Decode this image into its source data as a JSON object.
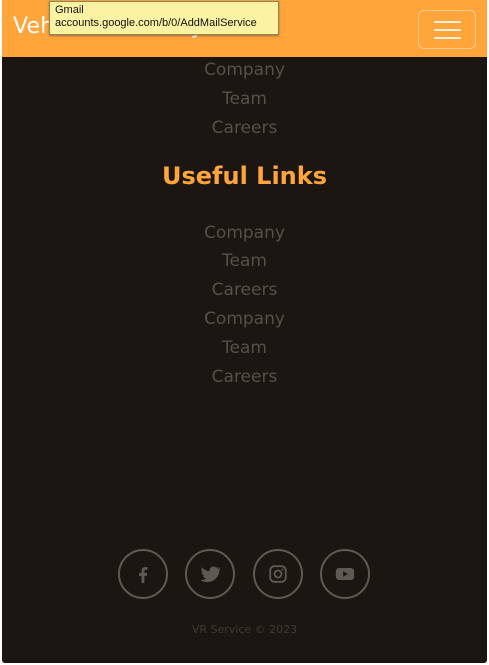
{
  "navbar": {
    "brand": "Vehicle Recovery",
    "toggle_label": "Toggle navigation"
  },
  "tooltip": {
    "title": "Gmail",
    "url": "accounts.google.com/b/0/AddMailService"
  },
  "footer": {
    "top_links": [
      "Company",
      "Team",
      "Careers"
    ],
    "useful_links_heading": "Useful Links",
    "useful_links": [
      "Company",
      "Team",
      "Careers",
      "Company",
      "Team",
      "Careers"
    ],
    "social_icons": [
      "facebook-icon",
      "twitter-icon",
      "instagram-icon",
      "youtube-icon"
    ],
    "copyright": "VR Service © 2023"
  },
  "colors": {
    "accent": "#ffa53a",
    "background": "#1c1612",
    "link": "#55504a",
    "tooltip_bg": "#fbf2a4"
  }
}
